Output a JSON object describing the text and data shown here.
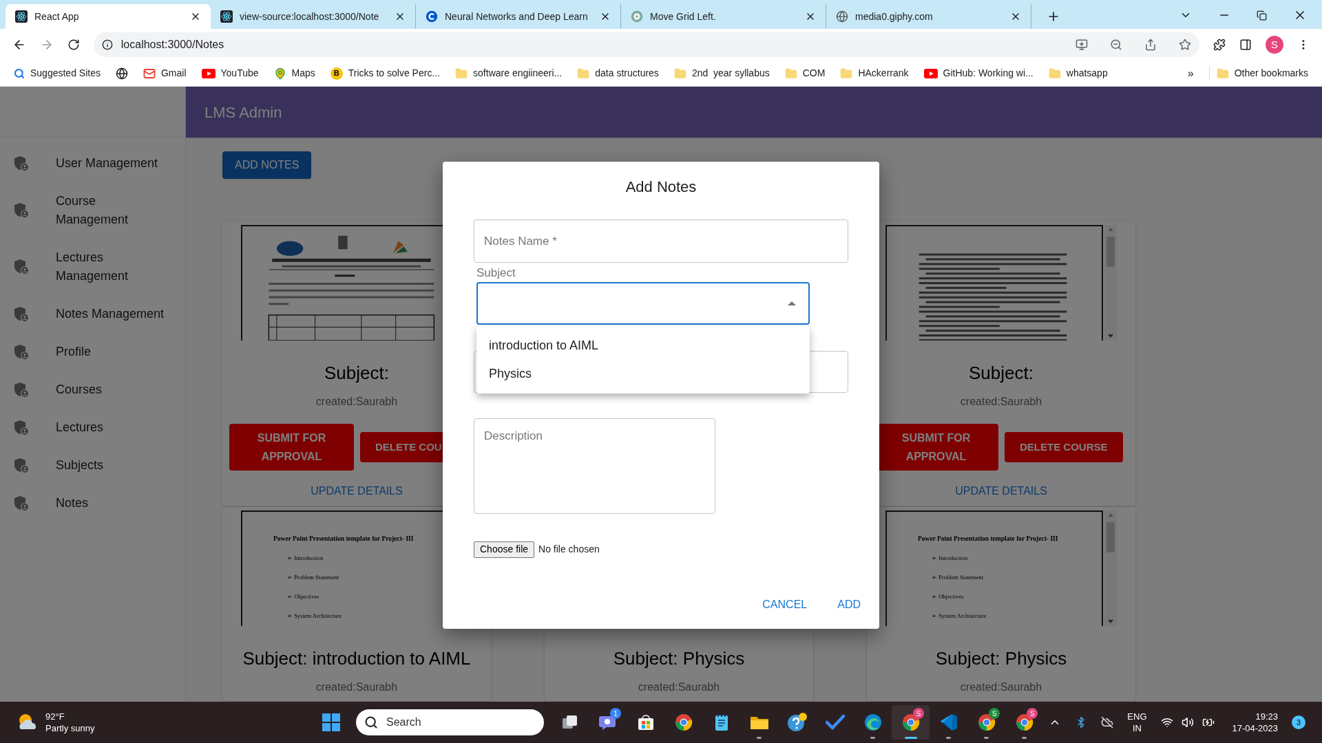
{
  "browser": {
    "tabs": [
      {
        "title": "React App",
        "selected": true,
        "kind": "react"
      },
      {
        "title": "view-source:localhost:3000/Note",
        "selected": false,
        "kind": "react"
      },
      {
        "title": "Neural Networks and Deep Learn",
        "selected": false,
        "kind": "ring"
      },
      {
        "title": "Move Grid Left.",
        "selected": false,
        "kind": "knot"
      },
      {
        "title": "media0.giphy.com",
        "selected": false,
        "kind": "globe"
      }
    ],
    "address": "localhost:3000/Notes",
    "profile": "S",
    "bookmarks": [
      {
        "kind": "search",
        "label": "Suggested Sites"
      },
      {
        "kind": "globe"
      },
      {
        "kind": "mail",
        "label": "Gmail"
      },
      {
        "kind": "video",
        "label": "YouTube"
      },
      {
        "kind": "pin",
        "label": "Maps"
      },
      {
        "kind": "letter",
        "letter": "B",
        "label": "Tricks to solve Perc..."
      },
      {
        "kind": "folder",
        "label": "software engiineeri..."
      },
      {
        "kind": "folder",
        "label": "data structures"
      },
      {
        "kind": "folder",
        "label": "2nd  year syllabus"
      },
      {
        "kind": "folder",
        "label": "COM"
      },
      {
        "kind": "folder",
        "label": "HAckerrank"
      },
      {
        "kind": "video",
        "label": "GitHub: Working wi..."
      },
      {
        "kind": "folder",
        "label": "whatsapp"
      }
    ],
    "overflow": "»",
    "other_bookmarks": "Other bookmarks"
  },
  "app": {
    "title": "LMS Admin",
    "sidebar": [
      "User Management",
      "Course Management",
      "Lectures Management",
      "Notes Management",
      "Profile",
      "Courses",
      "Lectures",
      "Subjects",
      "Notes"
    ],
    "add_button": "ADD NOTES",
    "top_cards": [
      {
        "subject": "Subject:",
        "created": "created:Saurabh",
        "submit": "SUBMIT FOR APPROVAL",
        "delete": "DELETE COU",
        "update": "UPDATE DETAILS"
      },
      {
        "preview": {
          "kind": "lines"
        },
        "subject": "Subject:",
        "created": "created:Saurabh",
        "submit": "SUBMIT FOR APPROVAL",
        "delete": "DELETE COURSE",
        "update": "UPDATE DETAILS"
      }
    ],
    "bottom_cards": [
      {
        "preview": {
          "kind": "outline",
          "title": "Power Point Presentation template for Project- III",
          "items": [
            "➢ Introduction",
            "➢ Problem Statement",
            "➢ Objectives",
            "➢ System Architecture"
          ]
        },
        "subject": "Subject: introduction to AIML",
        "created": "created:Saurabh"
      },
      {
        "subject": "Subject: Physics",
        "created": "created:Saurabh"
      },
      {
        "preview": {
          "kind": "outline",
          "title": "Power Point Presentation template for Project- III",
          "items": [
            "➢ Introduction",
            "➢ Problem Statement",
            "➢ Objectives",
            "➢ System Architecture"
          ]
        },
        "subject": "Subject: Physics",
        "created": "created:Saurabh"
      }
    ]
  },
  "dialog": {
    "title": "Add Notes",
    "name_placeholder": "Notes Name *",
    "subject_label": "Subject",
    "subject_open": true,
    "subject_options": [
      {
        "label": "introduction to AIML",
        "selected": false
      },
      {
        "label": "Physics",
        "selected": false
      }
    ],
    "description_placeholder": "Description",
    "file_button": "Choose file",
    "file_status": "No file chosen",
    "actions": [
      "CANCEL",
      "ADD"
    ]
  },
  "taskbar": {
    "weather": {
      "temp": "92°F",
      "condition": "Partly sunny"
    },
    "search_placeholder": "Search",
    "apps": [
      {
        "kind": "taskview",
        "running": false,
        "selected": false
      },
      {
        "kind": "chat",
        "badge": "1",
        "color": "#3b82f6",
        "running": false,
        "selected": false
      },
      {
        "kind": "store",
        "running": false,
        "selected": false
      },
      {
        "kind": "chrome",
        "running": false,
        "selected": false
      },
      {
        "kind": "notepad",
        "running": false,
        "selected": false
      },
      {
        "kind": "folder",
        "running": true,
        "selected": false
      },
      {
        "kind": "help",
        "running": false,
        "selected": false
      },
      {
        "kind": "check",
        "running": false,
        "selected": false
      },
      {
        "kind": "edge",
        "running": true,
        "selected": false
      },
      {
        "kind": "chrome",
        "badge": "S",
        "color": "#e0457b",
        "running": true,
        "selected": true
      },
      {
        "kind": "code",
        "running": true,
        "selected": false
      },
      {
        "kind": "chrome",
        "badge": "S",
        "color": "#1e8e3e",
        "running": true,
        "selected": false
      },
      {
        "kind": "chrome",
        "badge": "S",
        "color": "#e0457b",
        "running": true,
        "selected": false
      }
    ],
    "language": "ENG",
    "region": "IN",
    "time": "19:23",
    "date": "17-04-2023",
    "notifications": "3"
  }
}
